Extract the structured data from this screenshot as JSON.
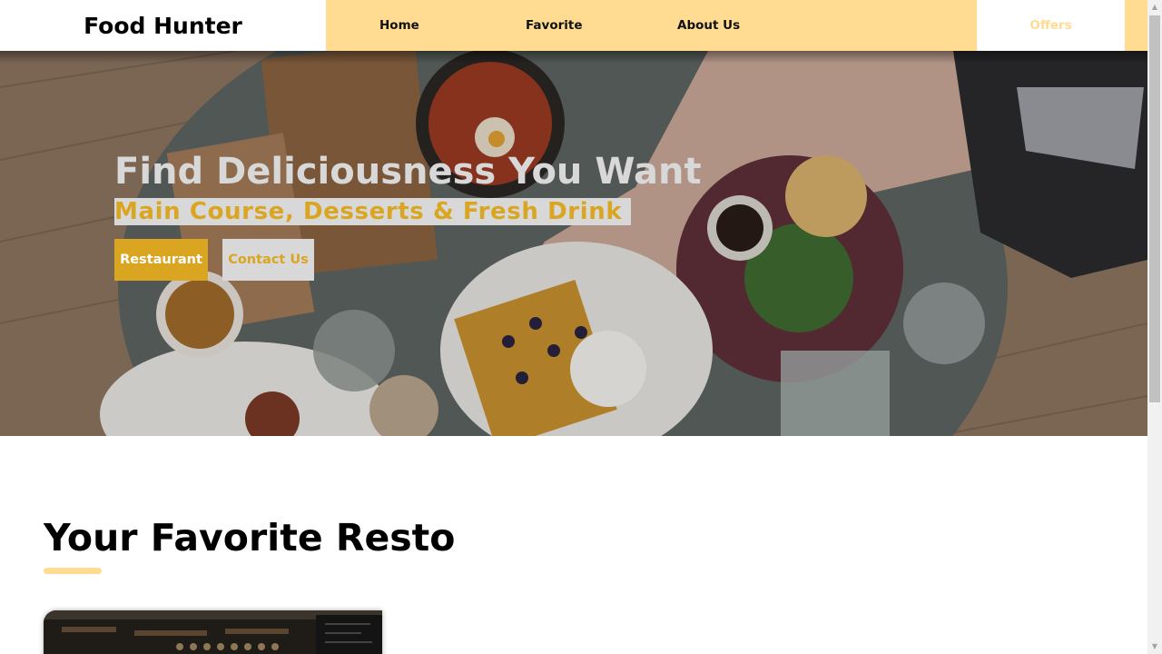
{
  "header": {
    "brand": "Food Hunter",
    "nav": {
      "home": "Home",
      "favorite": "Favorite",
      "about": "About Us",
      "offers": "Offers"
    }
  },
  "hero": {
    "title": "Find Deliciousness You Want",
    "subtitle": "Main Course, Desserts & Fresh Drink",
    "buttons": {
      "restaurant": "Restaurant",
      "contact": "Contact Us"
    },
    "image_icon": "restaurant-table-photo"
  },
  "section": {
    "title": "Your Favorite Resto",
    "card_image_icon": "restaurant-interior-photo"
  },
  "colors": {
    "accent": "#ffdc92",
    "gold": "#daa520",
    "hero_text": "#d8d8d8"
  }
}
